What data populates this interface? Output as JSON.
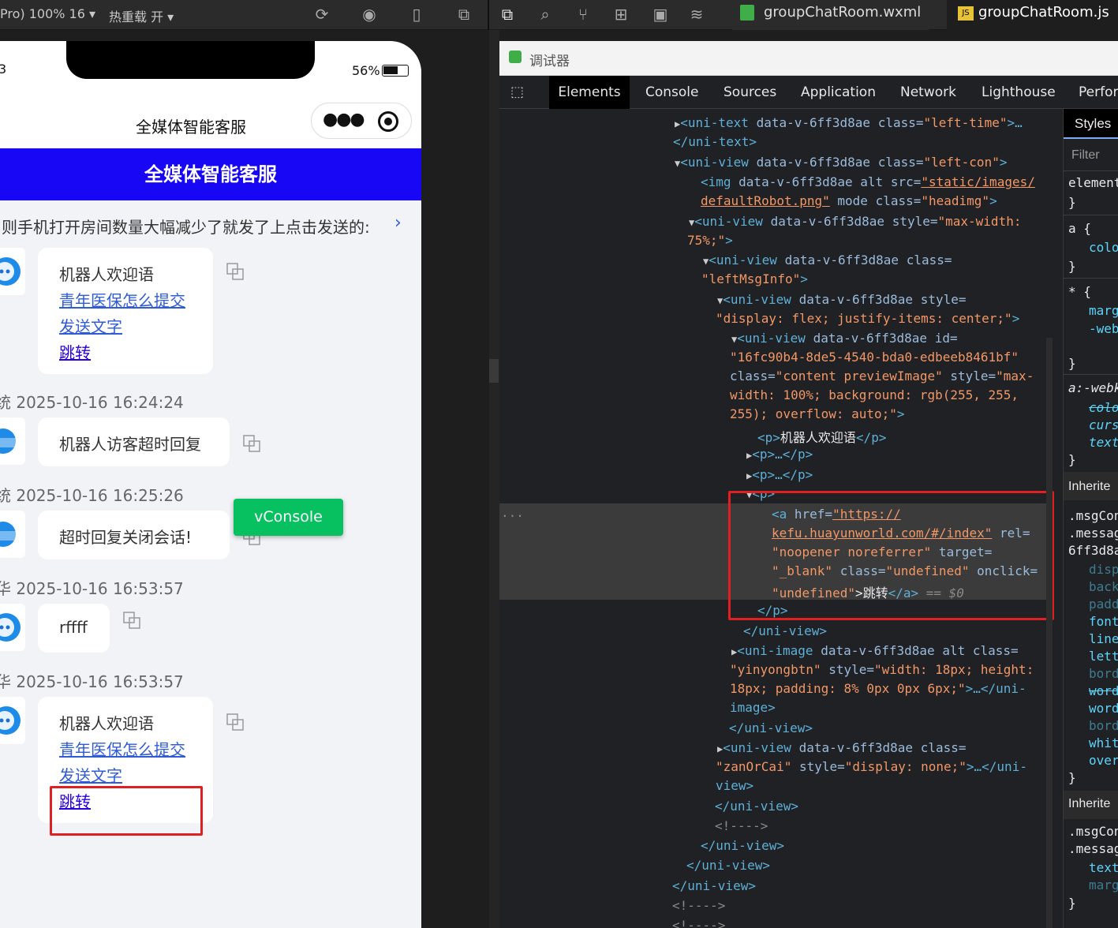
{
  "toolbar": {
    "device": "Pro) 100% 16 ▾",
    "hot_reload": "热重载 开 ▾",
    "tabs": [
      {
        "label": "groupChatRoom.wxml"
      },
      {
        "label": "groupChatRoom.js"
      }
    ]
  },
  "phone": {
    "clock": "3",
    "battery": "56%",
    "nav_title": "全媒体智能客服",
    "header_title": "全媒体智能客服",
    "notice": "则手机打开房间数量大幅减少了就发了上点击发送的:",
    "vconsole": "vConsole",
    "messages": [
      {
        "lines": [
          "机器人欢迎语"
        ],
        "links": [
          "青年医保怎么提交",
          "发送文字",
          "跳转"
        ]
      },
      {
        "timestamp": "统 2025-10-16 16:24:24",
        "text": "机器人访客超时回复"
      },
      {
        "timestamp": "统 2025-10-16 16:25:26",
        "text": "超时回复关闭会话!"
      },
      {
        "timestamp": "华 2025-10-16 16:53:57",
        "text": "rffff"
      },
      {
        "timestamp": "华 2025-10-16 16:53:57",
        "lines": [
          "机器人欢迎语"
        ],
        "links": [
          "青年医保怎么提交",
          "发送文字",
          "跳转"
        ]
      }
    ]
  },
  "devtools": {
    "title": "调试器",
    "tabs": [
      "Elements",
      "Console",
      "Sources",
      "Application",
      "Network",
      "Lighthouse",
      "Perfor"
    ],
    "active_tab": "Elements",
    "styles_tab": "Styles",
    "filter_placeholder": "Filter",
    "code": {
      "l1_tag": "<uni-text",
      "l1_attrs": " data-v-6ff3d8ae class=",
      "l1_val": "\"left-time\"",
      "l1_end": ">…",
      "l2": "</uni-text>",
      "l3_tag": "<uni-view",
      "l3_attrs": " data-v-6ff3d8ae class=",
      "l3_val": "\"left-con\"",
      "l3_end": ">",
      "l4_tag": "<img",
      "l4_attrs": " data-v-6ff3d8ae alt src=",
      "l4_val": "\"static/images/",
      "l5_val": "defaultRobot.png\"",
      "l5_attrs": " mode class=",
      "l5_val2": "\"headimg\"",
      "l5_end": ">",
      "l6_tag": "<uni-view",
      "l6_attrs": " data-v-6ff3d8ae style=",
      "l6_val": "\"max-width:",
      "l7_val": "75%;\"",
      "l7_end": ">",
      "l8_tag": "<uni-view",
      "l8_attrs": " data-v-6ff3d8ae class=",
      "l9_val": "\"leftMsgInfo\"",
      "l9_end": ">",
      "l10_tag": "<uni-view",
      "l10_attrs": " data-v-6ff3d8ae style=",
      "l11_val": "\"display: flex; justify-items: center;\"",
      "l11_end": ">",
      "l12_tag": "<uni-view",
      "l12_attrs": " data-v-6ff3d8ae id=",
      "l13_val": "\"16fc90b4-8de5-4540-bda0-edbeeb8461bf\"",
      "l14_attrs": "class=",
      "l14_val": "\"content previewImage\"",
      "l14_attrs2": " style=",
      "l14_val2": "\"max-",
      "l15_val": "width: 100%; background: rgb(255, 255,",
      "l16_val": "255); overflow: auto;\"",
      "l16_end": ">",
      "l17_tag": "<p>",
      "l17_text": "机器人欢迎语",
      "l17_close": "</p>",
      "l18": "<p>…</p>",
      "l19": "<p>…</p>",
      "l20": "<p>",
      "l21_tag": "<a",
      "l21_attrs": " href=",
      "l21_val": "\"https://",
      "l22_val": "kefu.huayunworld.com/#/index\"",
      "l22_attrs": " rel=",
      "l23_val": "\"noopener noreferrer\"",
      "l23_attrs": " target=",
      "l24_val": "\"_blank\"",
      "l24_attrs": " class=",
      "l24_val2": "\"undefined\"",
      "l24_attrs2": " onclick=",
      "l25_val": "\"undefined\"",
      "l25_text": ">跳转",
      "l25_close": "</a>",
      "l25_eq": " == $0",
      "l26": "</p>",
      "l27": "</uni-view>",
      "l28_tag": "<uni-image",
      "l28_attrs": " data-v-6ff3d8ae alt class=",
      "l29_val": "\"yinyongbtn\"",
      "l29_attrs": " style=",
      "l29_val2": "\"width: 18px; height:",
      "l30_val": "18px; padding: 8% 0px 0px 6px;\"",
      "l30_end": ">…</uni-",
      "l31": "image>",
      "l32": "</uni-view>",
      "l33_tag": "<uni-view",
      "l33_attrs": " data-v-6ff3d8ae class=",
      "l34_val": "\"zanOrCai\"",
      "l34_attrs": " style=",
      "l34_val2": "\"display: none;\"",
      "l34_end": ">…</uni-",
      "l35": "view>",
      "l36": "</uni-view>",
      "l37": "<!---->",
      "l38": "</uni-view>",
      "l39": "</uni-view>",
      "l40": "</uni-view>",
      "l41": "<!---->",
      "l42": "<!---->",
      "ellipsis": "..."
    },
    "styles": {
      "s1": "element",
      "s2": "}",
      "s3": "a {",
      "s4": "colo",
      "s5": "}",
      "s6": "* {",
      "s7": "marg",
      "s8": "-web",
      "s9": "}",
      "s10": "a:-webk",
      "s11": "colo",
      "s12": "curs",
      "s13": "text",
      "s14": "}",
      "s15": "Inherite",
      "s16": ".msgCon",
      "s17": ".messag",
      "s18": "6ff3d8a",
      "s19": "disp",
      "s20": "back",
      "s21": "padd",
      "s22": "font",
      "s23": "line",
      "s24": "lett",
      "s25": "bord",
      "s26": "word",
      "s27": "word",
      "s28": "bord",
      "s29": "whit",
      "s30": "over",
      "s31": "}",
      "s32": "Inherite",
      "s33": ".msgCon",
      "s34": ".messag",
      "s35": "text",
      "s36": "marg",
      "s37": "}"
    }
  }
}
